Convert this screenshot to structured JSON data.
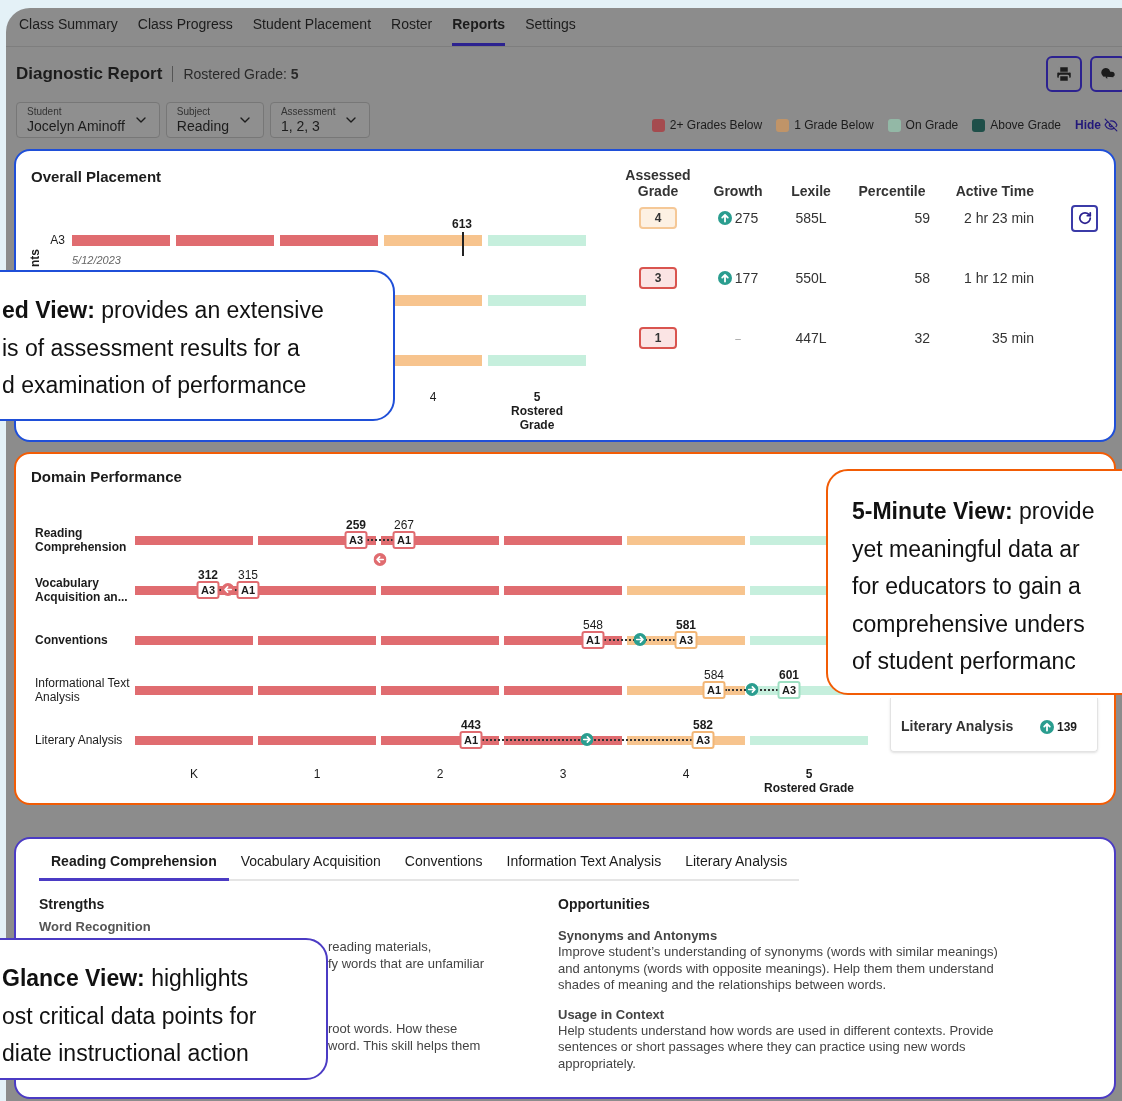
{
  "nav_tabs": [
    {
      "label": "Class Summary",
      "selected": false
    },
    {
      "label": "Class Progress",
      "selected": false
    },
    {
      "label": "Student Placement",
      "selected": false
    },
    {
      "label": "Roster",
      "selected": false
    },
    {
      "label": "Reports",
      "selected": true
    },
    {
      "label": "Settings",
      "selected": false
    }
  ],
  "header": {
    "title": "Diagnostic Report",
    "subtitle": "Rostered Grade: **5**",
    "buttons": [
      {
        "kind": "print"
      },
      {
        "kind": "download"
      }
    ]
  },
  "filters": [
    {
      "label": "Student",
      "value": "Jocelyn Aminoff"
    },
    {
      "label": "Subject",
      "value": "Reading"
    },
    {
      "label": "Assessment",
      "value": "1, 2, 3"
    }
  ],
  "legend": [
    {
      "label": "2+ Grades Below",
      "color": "#a54b4f"
    },
    {
      "label": "1 Grade Below",
      "color": "#c09468"
    },
    {
      "label": "On Grade",
      "color": "#93b8a6"
    },
    {
      "label": "Above Grade",
      "color": "#1f4f49"
    }
  ],
  "legend_toggle": "Hide",
  "overall_placement": {
    "title": "Overall Placement",
    "axis_title_fragment": "nts",
    "segments": [
      {
        "kind": "two_below"
      },
      {
        "kind": "two_below"
      },
      {
        "kind": "two_below"
      },
      {
        "kind": "one_below",
        "label": "4"
      },
      {
        "kind": "on_grade",
        "label": "5",
        "note": "Rostered Grade"
      }
    ],
    "columns": [
      "Assessed Grade",
      "Growth",
      "Lexile",
      "Percentile",
      "Active Time"
    ],
    "rows": [
      {
        "label": "A3",
        "date": "5/12/2023",
        "marker": "613",
        "badge": {
          "text": "4",
          "kind": "one_below"
        },
        "growth": {
          "value": "275",
          "kind": "up"
        },
        "lexile": "585L",
        "percentile": "59",
        "active_time": "2 hr 23 min",
        "refresh": true
      },
      {
        "badge": {
          "text": "3",
          "kind": "two_below"
        },
        "growth": {
          "value": "177",
          "kind": "up"
        },
        "lexile": "550L",
        "percentile": "58",
        "active_time": "1 hr 12 min",
        "refresh": false
      },
      {
        "badge": {
          "text": "1",
          "kind": "two_below"
        },
        "growth": {
          "value": "–",
          "kind": "none"
        },
        "lexile": "447L",
        "percentile": "32",
        "active_time": "35 min",
        "refresh": false
      }
    ]
  },
  "domain_performance": {
    "title": "Domain Performance",
    "grades": [
      {
        "label": "K",
        "kind": "two_below"
      },
      {
        "label": "1",
        "kind": "two_below"
      },
      {
        "label": "2",
        "kind": "two_below"
      },
      {
        "label": "3",
        "kind": "two_below"
      },
      {
        "label": "4",
        "kind": "one_below"
      },
      {
        "label": "5",
        "kind": "on_grade",
        "note": "Rostered Grade"
      }
    ],
    "rows": [
      {
        "label": "Reading Comprehension",
        "emphasized": true,
        "arrow": {
          "kind": "decline"
        },
        "markers": [
          {
            "label": "A3",
            "score": "259",
            "emphasized": true
          },
          {
            "label": "A1",
            "score": "267",
            "emphasized": false
          }
        ]
      },
      {
        "label": "Vocabulary Acquisition an...",
        "emphasized": true,
        "arrow": {
          "kind": "decline"
        },
        "markers": [
          {
            "label": "A3",
            "score": "312",
            "emphasized": true
          },
          {
            "label": "A1",
            "score": "315",
            "emphasized": false
          }
        ]
      },
      {
        "label": "Conventions",
        "emphasized": true,
        "arrow": {
          "kind": "improve"
        },
        "markers": [
          {
            "label": "A1",
            "score": "548",
            "emphasized": false
          },
          {
            "label": "A3",
            "score": "581",
            "emphasized": true
          }
        ]
      },
      {
        "label": "Informational Text Analysis",
        "emphasized": false,
        "arrow": {
          "kind": "improve"
        },
        "markers": [
          {
            "label": "A1",
            "score": "584",
            "emphasized": false
          },
          {
            "label": "A3",
            "score": "601",
            "emphasized": true
          }
        ]
      },
      {
        "label": "Literary Analysis",
        "emphasized": false,
        "arrow": {
          "kind": "improve"
        },
        "markers": [
          {
            "label": "A1",
            "score": "443",
            "emphasized": true
          },
          {
            "label": "A3",
            "score": "582",
            "emphasized": true
          }
        ]
      }
    ],
    "side_panel": [
      {
        "label": "Literary Analysis",
        "growth": {
          "value": "139",
          "kind": "up"
        }
      }
    ]
  },
  "details": {
    "tabs": [
      {
        "label": "Reading Comprehension",
        "selected": true
      },
      {
        "label": "Vocabulary Acquisition",
        "selected": false
      },
      {
        "label": "Conventions",
        "selected": false
      },
      {
        "label": "Information Text Analysis",
        "selected": false
      },
      {
        "label": "Literary Analysis",
        "selected": false
      }
    ],
    "strengths": {
      "title": "Strengths",
      "heading": "Word Recognition",
      "fragments": [
        "reading materials,",
        "fy words that are unfamiliar",
        "root words. How these",
        "word. This skill helps them"
      ]
    },
    "opportunities": {
      "title": "Opportunities",
      "items": [
        {
          "title": "Synonyms and Antonyms",
          "text": "Improve student’s understanding of synonyms (words with similar meanings) and antonyms (words with opposite meanings). Help them them understand shades of meaning and the relationships between words."
        },
        {
          "title": "Usage in Context",
          "text": "Help students understand how words are used in different contexts. Provide sentences or short passages where they can practice using new words appropriately."
        }
      ]
    }
  },
  "callouts": [
    {
      "kind": "detailed",
      "lines": [
        "**ed View:** provides an extensive",
        "is of assessment results for a",
        "d examination of performance"
      ]
    },
    {
      "kind": "five_minute",
      "lines": [
        "**5-Minute View:** provide",
        "yet meaningful data ar",
        "for educators to gain a",
        "comprehensive unders",
        "of student performanc"
      ]
    },
    {
      "kind": "glance",
      "lines": [
        "**Glance View:** highlights",
        "ost critical data points for",
        "diate instructional action"
      ]
    }
  ]
}
